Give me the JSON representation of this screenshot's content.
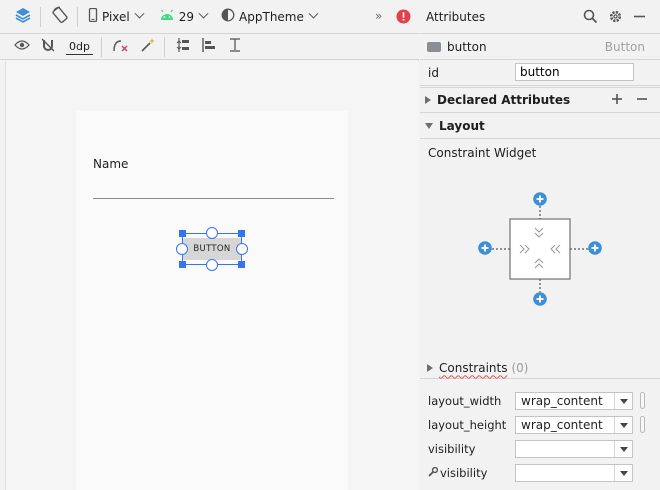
{
  "toolbar": {
    "device_label": "Pixel",
    "api_level": "29",
    "theme_label": "AppTheme",
    "overflow": "»",
    "default_margin": "0dp"
  },
  "preview": {
    "name_label": "Name",
    "button_text": "BUTTON"
  },
  "attributes": {
    "title": "Attributes",
    "component_name": "button",
    "component_type": "Button",
    "id_label": "id",
    "id_value": "button",
    "declared_label": "Declared Attributes",
    "layout_label": "Layout",
    "constraint_widget_label": "Constraint Widget",
    "constraints_label": "Constraints",
    "constraints_count": "(0)",
    "props": [
      {
        "label": "layout_width",
        "value": "wrap_content"
      },
      {
        "label": "layout_height",
        "value": "wrap_content"
      },
      {
        "label": "visibility",
        "value": ""
      },
      {
        "label": "visibility",
        "value": ""
      }
    ]
  },
  "colors": {
    "accent": "#3574f0",
    "constraint_blue": "#3d8fd6",
    "error": "#e0424b"
  }
}
